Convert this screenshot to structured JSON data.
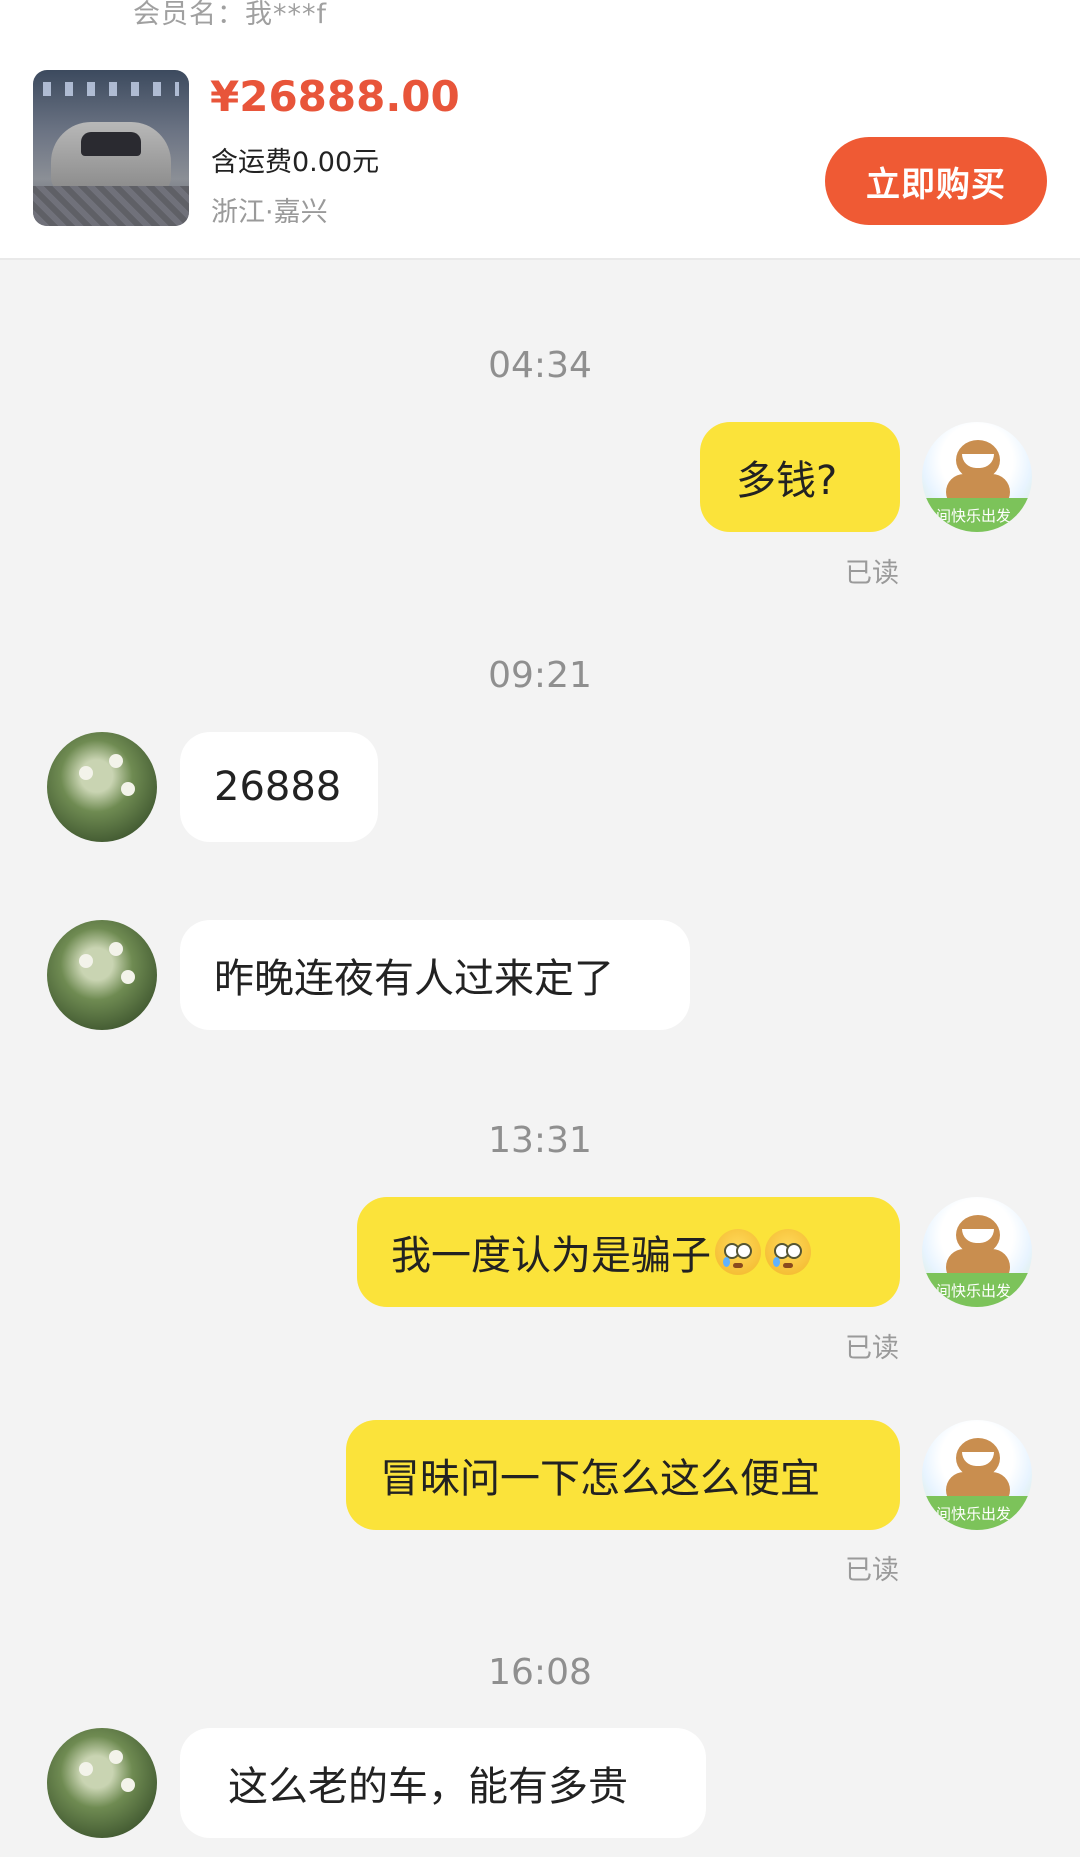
{
  "product": {
    "member_label": "会员名：我***f",
    "price": "¥26888.00",
    "shipping": "含运费0.00元",
    "location": "浙江·嘉兴",
    "buy_button": "立即购买"
  },
  "chat": {
    "time_1": "04:34",
    "msg_1": "多钱?",
    "read_1": "已读",
    "time_2": "09:21",
    "msg_2": "26888",
    "msg_3": "昨晚连夜有人过来定了",
    "time_3": "13:31",
    "msg_4": "我一度认为是骗子",
    "read_4": "已读",
    "msg_5": "冒昧问一下怎么这么便宜",
    "read_5": "已读",
    "time_4": "16:08",
    "msg_6": "这么老的车，能有多贵",
    "avatar_tag": "间快乐出发"
  },
  "colors": {
    "price": "#e8553a",
    "buy_button": "#ef5a34",
    "my_bubble": "#fbe33a",
    "their_bubble": "#ffffff",
    "background": "#f3f3f3"
  },
  "icons": {
    "my_avatar": "cartoon-bear-avatar",
    "their_avatar": "flower-photo-avatar",
    "emoji": "crying-face-emoji"
  }
}
